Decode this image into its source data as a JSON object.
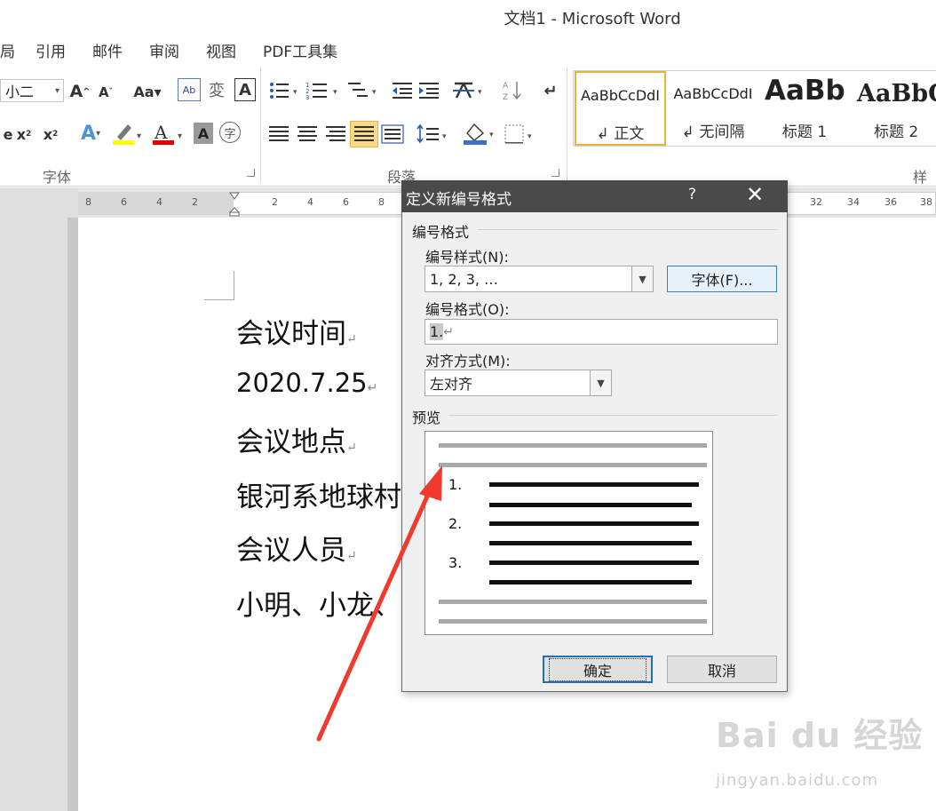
{
  "window": {
    "title": "文档1 - Microsoft Word"
  },
  "menu": {
    "items": [
      "局",
      "引用",
      "邮件",
      "审阅",
      "视图",
      "PDF工具集"
    ]
  },
  "ribbon": {
    "font_size": "小二",
    "font_group_label": "字体",
    "paragraph_group_label": "段落",
    "styles_group_label": "样式",
    "styles": [
      {
        "sample": "AaBbCcDdI",
        "name": "↲ 正文"
      },
      {
        "sample": "AaBbCcDdI",
        "name": "↲ 无间隔"
      },
      {
        "sample": "AaBb",
        "name": "标题 1"
      },
      {
        "sample": "AaBbC",
        "name": "标题 2"
      }
    ]
  },
  "ruler": {
    "labels": [
      "8",
      "6",
      "4",
      "2",
      "2",
      "4",
      "6",
      "8",
      "32",
      "34",
      "36",
      "38"
    ]
  },
  "document": {
    "lines": [
      "会议时间",
      "2020.7.25",
      "会议地点",
      "银河系地球村",
      "会议人员",
      "小明、小龙、"
    ]
  },
  "dialog": {
    "title": "定义新编号格式",
    "help": "?",
    "close": "✕",
    "section_number_format": "编号格式",
    "number_style_label": "编号样式(N):",
    "number_style_value": "1, 2, 3, …",
    "font_button": "字体(F)...",
    "number_format_label": "编号格式(O):",
    "number_format_value": "1.",
    "alignment_label": "对齐方式(M):",
    "alignment_value": "左对齐",
    "preview_label": "预览",
    "preview_numbers": [
      "1.",
      "2.",
      "3."
    ],
    "ok_button": "确定",
    "cancel_button": "取消"
  },
  "watermark": {
    "brand": "Bai du 经验",
    "url": "jingyan.baidu.com"
  },
  "colors": {
    "annotation_arrow": "#f03a2e",
    "dialog_title_bg": "#4a4a4a",
    "selected_style_border": "#f0b232"
  }
}
